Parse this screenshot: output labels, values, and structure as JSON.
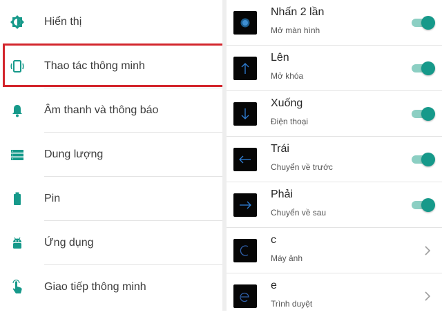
{
  "settings_menu": {
    "items": [
      {
        "label": "Hiển thị",
        "icon": "brightness-icon"
      },
      {
        "label": "Thao tác thông minh",
        "icon": "phone-gesture-icon"
      },
      {
        "label": "Âm thanh và thông báo",
        "icon": "bell-icon"
      },
      {
        "label": "Dung lượng",
        "icon": "storage-icon"
      },
      {
        "label": "Pin",
        "icon": "battery-icon"
      },
      {
        "label": "Ứng dụng",
        "icon": "android-icon"
      },
      {
        "label": "Giao tiếp thông minh",
        "icon": "hand-touch-icon"
      }
    ],
    "highlighted_item": "Thao tác thông minh"
  },
  "gestures": {
    "items": [
      {
        "title": "Nhấn 2 lần",
        "subtitle": "Mở màn hình",
        "gesture_icon": "double-tap-icon",
        "control": "toggle",
        "enabled": true
      },
      {
        "title": "Lên",
        "subtitle": "Mở khóa",
        "gesture_icon": "arrow-up-icon",
        "control": "toggle",
        "enabled": true
      },
      {
        "title": "Xuống",
        "subtitle": "Điện thoại",
        "gesture_icon": "arrow-down-icon",
        "control": "toggle",
        "enabled": true
      },
      {
        "title": "Trái",
        "subtitle": "Chuyển về trước",
        "gesture_icon": "arrow-left-icon",
        "control": "toggle",
        "enabled": true
      },
      {
        "title": "Phải",
        "subtitle": "Chuyển về sau",
        "gesture_icon": "arrow-right-icon",
        "control": "toggle",
        "enabled": true
      },
      {
        "title": "c",
        "subtitle": "Máy ảnh",
        "gesture_icon": "letter-c-gesture-icon",
        "control": "chevron"
      },
      {
        "title": "e",
        "subtitle": "Trình duyệt",
        "gesture_icon": "letter-e-gesture-icon",
        "control": "chevron"
      }
    ]
  },
  "colors": {
    "accent": "#16998a",
    "highlight_border": "#d3252c",
    "gesture_stroke": "#2f7fd6"
  }
}
